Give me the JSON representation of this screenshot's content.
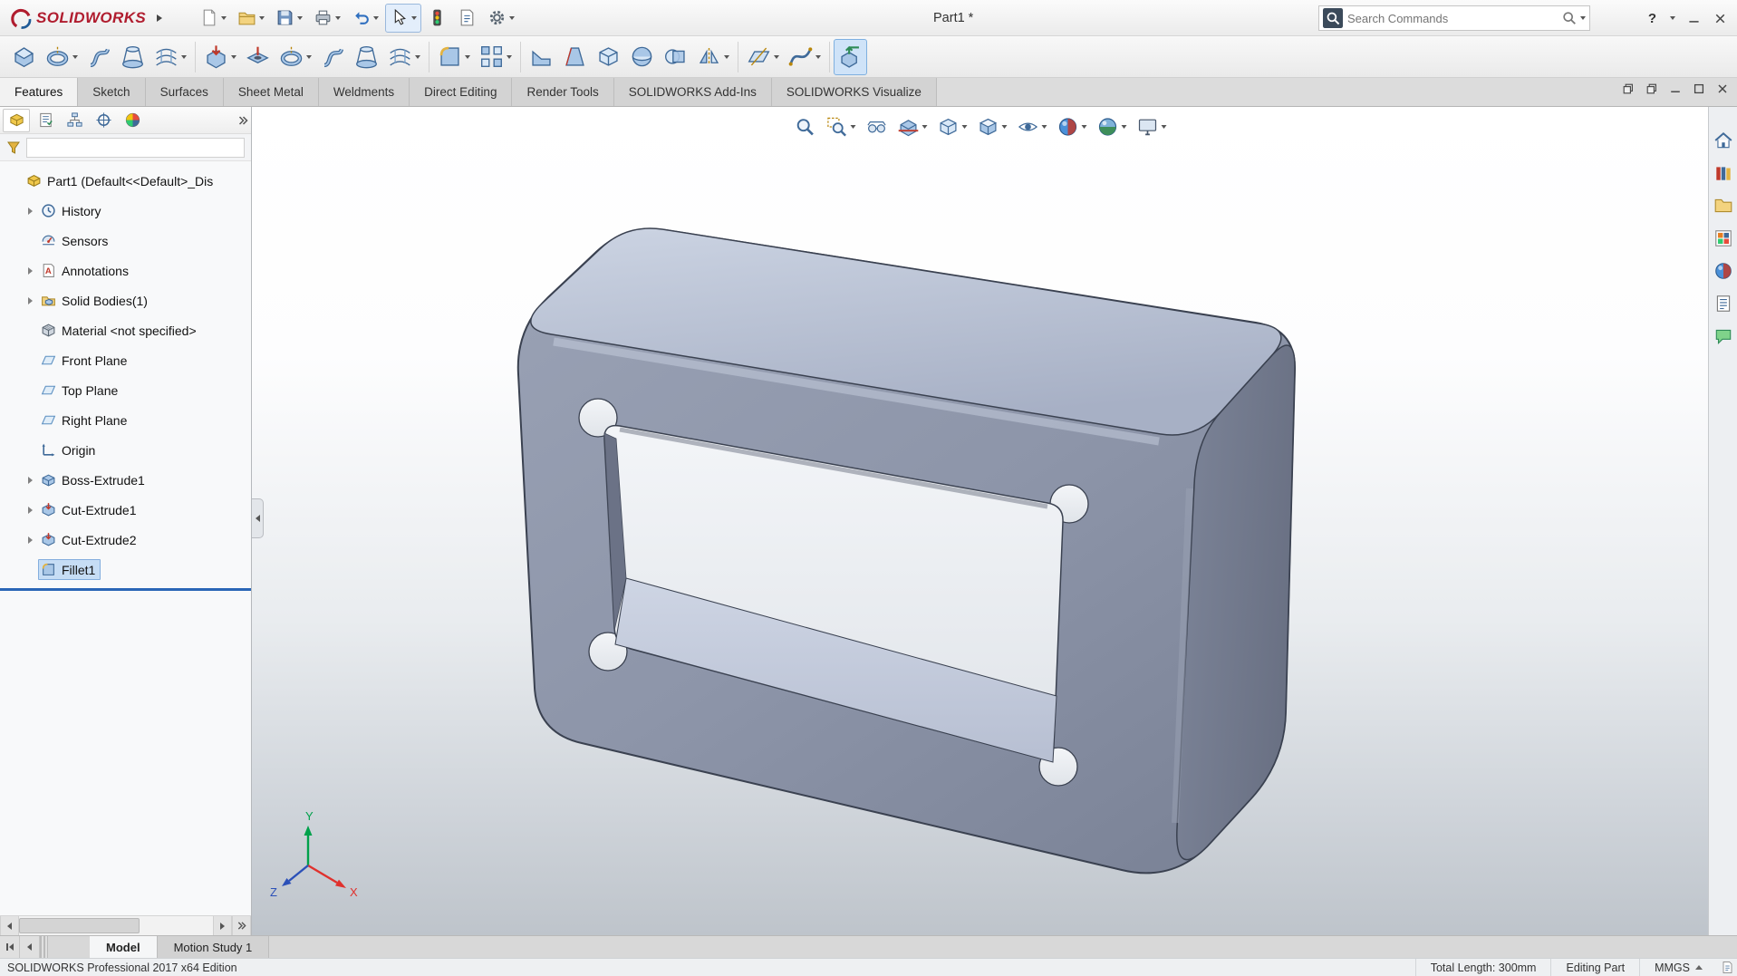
{
  "titlebar": {
    "logo_text": "SOLIDWORKS",
    "document_title": "Part1 *",
    "search_placeholder": "Search Commands",
    "help_label": "?",
    "quick_tools": [
      "new-document",
      "open",
      "save",
      "print",
      "undo",
      "select",
      "selection-lights",
      "file-properties",
      "options"
    ]
  },
  "features_toolbar": {
    "icons": [
      "extruded-boss-base",
      "revolved-boss-base",
      "swept-boss-base",
      "lofted-boss-base",
      "boundary-boss-base",
      "extruded-cut",
      "hole-wizard",
      "revolved-cut",
      "swept-cut",
      "lofted-cut",
      "boundary-cut",
      "fillet",
      "linear-pattern",
      "rib",
      "draft",
      "shell",
      "wrap",
      "intersect",
      "mirror",
      "reference-geometry",
      "curves",
      "instant3d"
    ],
    "active_icon": "instant3d"
  },
  "command_tabs": {
    "tabs": [
      {
        "label": "Features",
        "active": true
      },
      {
        "label": "Sketch"
      },
      {
        "label": "Surfaces"
      },
      {
        "label": "Sheet Metal"
      },
      {
        "label": "Weldments"
      },
      {
        "label": "Direct Editing"
      },
      {
        "label": "Render Tools"
      },
      {
        "label": "SOLIDWORKS Add-Ins"
      },
      {
        "label": "SOLIDWORKS Visualize"
      }
    ]
  },
  "left_panel": {
    "manager_tabs": [
      "featuremanager-design-tree",
      "propertymanager",
      "configurationmanager",
      "dimxpertmanager",
      "displaymanager"
    ],
    "filter_value": ""
  },
  "feature_tree": {
    "root_label": "Part1  (Default<<Default>_Dis",
    "items": [
      {
        "label": "History",
        "icon": "history",
        "expandable": true
      },
      {
        "label": "Sensors",
        "icon": "sensors",
        "expandable": false
      },
      {
        "label": "Annotations",
        "icon": "annotations",
        "expandable": true
      },
      {
        "label": "Solid Bodies(1)",
        "icon": "solid-bodies",
        "expandable": true
      },
      {
        "label": "Material <not specified>",
        "icon": "material",
        "expandable": false
      },
      {
        "label": "Front Plane",
        "icon": "plane",
        "expandable": false
      },
      {
        "label": "Top Plane",
        "icon": "plane",
        "expandable": false
      },
      {
        "label": "Right Plane",
        "icon": "plane",
        "expandable": false
      },
      {
        "label": "Origin",
        "icon": "origin",
        "expandable": false
      },
      {
        "label": "Boss-Extrude1",
        "icon": "boss-extrude",
        "expandable": true
      },
      {
        "label": "Cut-Extrude1",
        "icon": "cut-extrude",
        "expandable": true
      },
      {
        "label": "Cut-Extrude2",
        "icon": "cut-extrude",
        "expandable": true
      },
      {
        "label": "Fillet1",
        "icon": "fillet",
        "expandable": false,
        "selected": true
      }
    ]
  },
  "viewport": {
    "headsup_tools": [
      "zoom-to-fit",
      "zoom-to-area",
      "previous-view",
      "section-view",
      "view-orientation",
      "display-style",
      "hide-show-items",
      "edit-appearance",
      "apply-scene",
      "view-settings"
    ],
    "triad": {
      "x_label": "X",
      "y_label": "Y",
      "z_label": "Z"
    },
    "model_colors": {
      "top_face": "#b7bfd2",
      "front_face": "#8f97ab",
      "right_face": "#747c90",
      "inner_floor": "#c4cbdc",
      "inner_wall": "#6b7286",
      "edge": "#3a4150"
    }
  },
  "task_pane": {
    "icons": [
      "solidworks-resources",
      "design-library",
      "file-explorer",
      "view-palette",
      "appearances-scenes",
      "custom-properties",
      "solidworks-forum"
    ]
  },
  "bottom_bar": {
    "tabs": [
      {
        "label": "Model",
        "active": true
      },
      {
        "label": "Motion Study 1",
        "active": false
      }
    ]
  },
  "statusbar": {
    "edition": "SOLIDWORKS Professional 2017 x64 Edition",
    "measurement": "Total Length: 300mm",
    "mode": "Editing Part",
    "units": "MMGS"
  }
}
